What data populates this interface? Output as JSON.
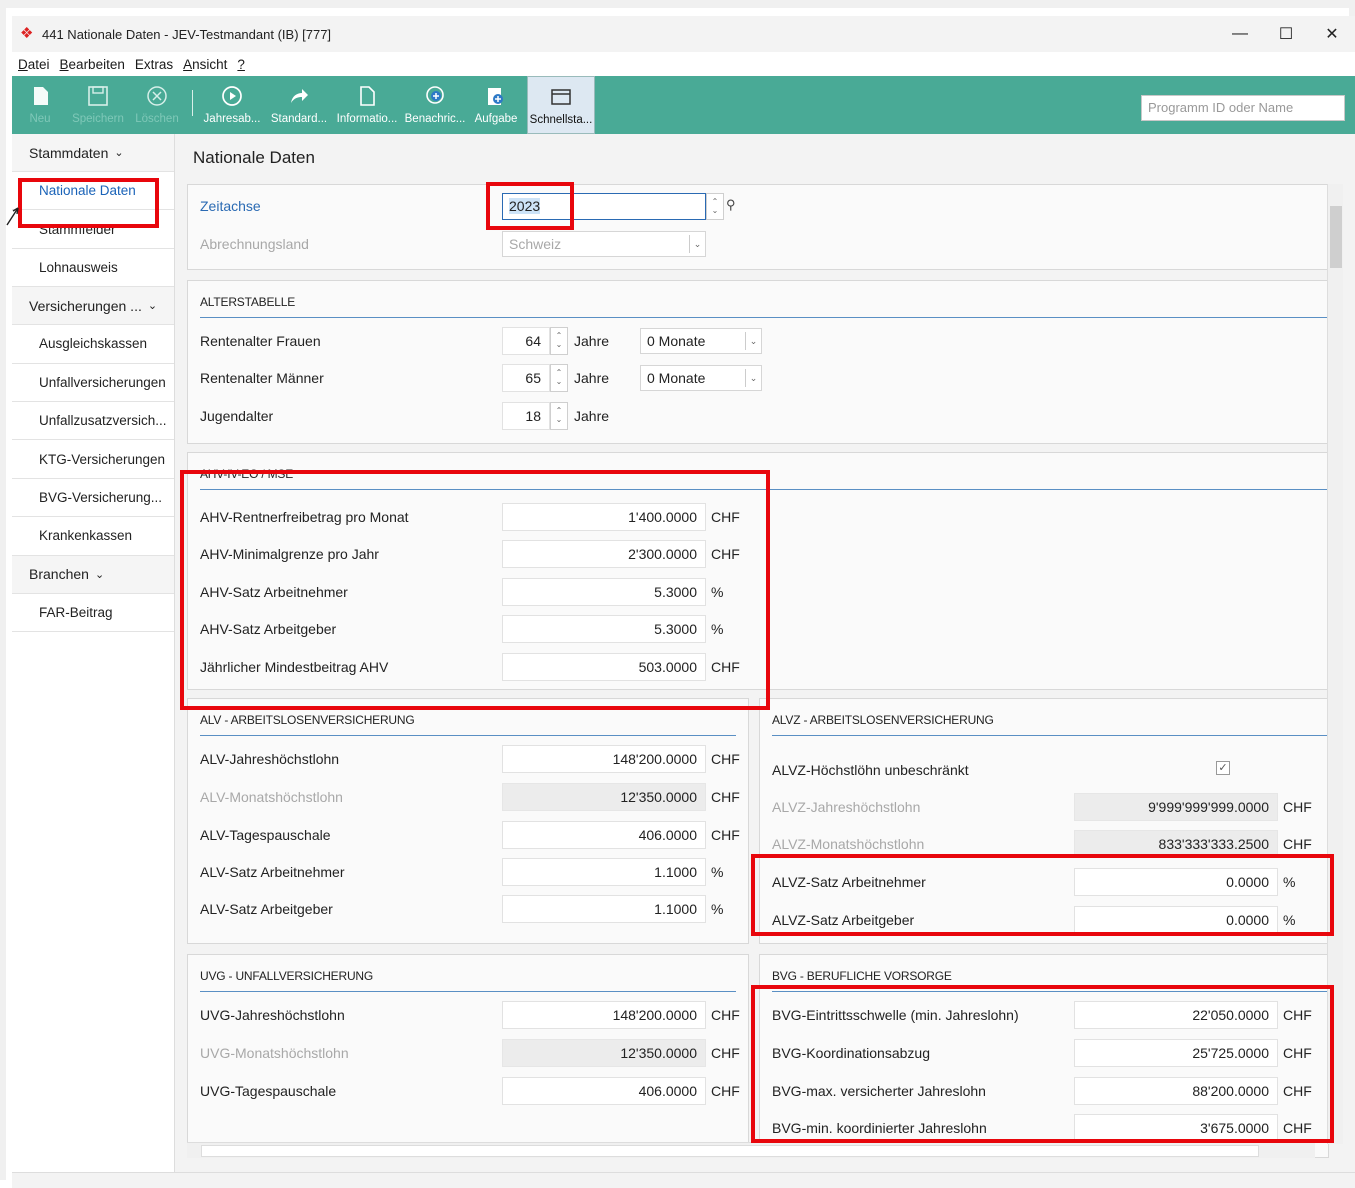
{
  "window": {
    "title": "441 Nationale Daten - JEV-Testmandant (IB) [777]",
    "minimize": "—",
    "maximize": "☐",
    "close": "✕"
  },
  "menu": [
    {
      "pre": "",
      "u": "D",
      "post": "atei"
    },
    {
      "pre": "",
      "u": "B",
      "post": "earbeiten"
    },
    {
      "pre": "Extras",
      "u": "",
      "post": ""
    },
    {
      "pre": "",
      "u": "A",
      "post": "nsicht"
    },
    {
      "pre": "",
      "u": "?",
      "post": ""
    }
  ],
  "toolbar": {
    "neu": "Neu",
    "speichern": "Speichern",
    "loeschen": "Löschen",
    "jahresab": "Jahresab...",
    "standard": "Standard...",
    "informatio": "Informatio...",
    "benachric": "Benachric...",
    "aufgabe": "Aufgabe",
    "schnellsta": "Schnellsta...",
    "search_placeholder": "Programm ID oder Name"
  },
  "sidebar": {
    "group1": "Stammdaten",
    "items1": [
      "Nationale Daten",
      "Stammfelder",
      "Lohnausweis"
    ],
    "group2": "Versicherungen ...",
    "items2": [
      "Ausgleichskassen",
      "Unfallversicherungen",
      "Unfallzusatzversich...",
      "KTG-Versicherungen",
      "BVG-Versicherung...",
      "Krankenkassen"
    ],
    "group3": "Branchen",
    "items3": [
      "FAR-Beitrag"
    ]
  },
  "page": {
    "title": "Nationale Daten"
  },
  "header": {
    "zeitachse_label": "Zeitachse",
    "zeitachse_value": "2023",
    "land_label": "Abrechnungsland",
    "land_value": "Schweiz"
  },
  "alter": {
    "title": "ALTERSTABELLE",
    "frauen_label": "Rentenalter Frauen",
    "frauen_value": "64",
    "frauen_monate": "0 Monate",
    "maenner_label": "Rentenalter Männer",
    "maenner_value": "65",
    "maenner_monate": "0 Monate",
    "jugend_label": "Jugendalter",
    "jugend_value": "18",
    "jahre": "Jahre"
  },
  "ahv": {
    "title": "AHV-IV-EO / MSE",
    "rows": [
      {
        "label": "AHV-Rentnerfreibetrag pro Monat",
        "value": "1'400.0000",
        "unit": "CHF"
      },
      {
        "label": "AHV-Minimalgrenze pro Jahr",
        "value": "2'300.0000",
        "unit": "CHF"
      },
      {
        "label": "AHV-Satz Arbeitnehmer",
        "value": "5.3000",
        "unit": "%"
      },
      {
        "label": "AHV-Satz Arbeitgeber",
        "value": "5.3000",
        "unit": "%"
      },
      {
        "label": "Jährlicher Mindestbeitrag AHV",
        "value": "503.0000",
        "unit": "CHF"
      }
    ]
  },
  "alv": {
    "title": "ALV - ARBEITSLOSENVERSICHERUNG",
    "rows": [
      {
        "label": "ALV-Jahreshöchstlohn",
        "value": "148'200.0000",
        "unit": "CHF"
      },
      {
        "label": "ALV-Monatshöchstlohn",
        "value": "12'350.0000",
        "unit": "CHF"
      },
      {
        "label": "ALV-Tagespauschale",
        "value": "406.0000",
        "unit": "CHF"
      },
      {
        "label": "ALV-Satz Arbeitnehmer",
        "value": "1.1000",
        "unit": "%"
      },
      {
        "label": "ALV-Satz Arbeitgeber",
        "value": "1.1000",
        "unit": "%"
      }
    ]
  },
  "alvz": {
    "title": "ALVZ - ARBEITSLOSENVERSICHERUNG",
    "unbeschraenkt_label": "ALVZ-Höchstlöhn unbeschränkt",
    "rows": [
      {
        "label": "ALVZ-Jahreshöchstlohn",
        "value": "9'999'999'999.0000",
        "unit": "CHF"
      },
      {
        "label": "ALVZ-Monatshöchstlohn",
        "value": "833'333'333.2500",
        "unit": "CHF"
      },
      {
        "label": "ALVZ-Satz Arbeitnehmer",
        "value": "0.0000",
        "unit": "%"
      },
      {
        "label": "ALVZ-Satz Arbeitgeber",
        "value": "0.0000",
        "unit": "%"
      }
    ]
  },
  "uvg": {
    "title": "UVG - UNFALLVERSICHERUNG",
    "rows": [
      {
        "label": "UVG-Jahreshöchstlohn",
        "value": "148'200.0000",
        "unit": "CHF"
      },
      {
        "label": "UVG-Monatshöchstlohn",
        "value": "12'350.0000",
        "unit": "CHF"
      },
      {
        "label": "UVG-Tagespauschale",
        "value": "406.0000",
        "unit": "CHF"
      }
    ]
  },
  "bvg": {
    "title": "BVG - BERUFLICHE VORSORGE",
    "rows": [
      {
        "label": "BVG-Eintrittsschwelle (min. Jahreslohn)",
        "value": "22'050.0000",
        "unit": "CHF"
      },
      {
        "label": "BVG-Koordinationsabzug",
        "value": "25'725.0000",
        "unit": "CHF"
      },
      {
        "label": "BVG-max. versicherter Jahreslohn",
        "value": "88'200.0000",
        "unit": "CHF"
      },
      {
        "label": "BVG-min. koordinierter Jahreslohn",
        "value": "3'675.0000",
        "unit": "CHF"
      }
    ]
  },
  "colors": {
    "toolbar": "#49aa96",
    "highlight": "#e8060c",
    "link": "#2a6ab3"
  }
}
